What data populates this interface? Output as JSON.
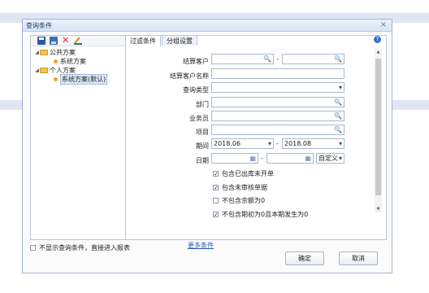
{
  "dialog": {
    "title": "查询条件",
    "close": "×"
  },
  "left": {
    "toolbar": {
      "save_icon": "save-icon",
      "saveas_icon": "save-as-icon",
      "delete_icon": "delete-icon",
      "edit_icon": "edit-icon"
    },
    "tree": [
      {
        "label": "公共方案",
        "children": [
          "系统方案"
        ]
      },
      {
        "label": "个人方案",
        "children": [
          "系统方案(默认)"
        ]
      }
    ]
  },
  "tabs": [
    "过滤条件",
    "分组设置"
  ],
  "help": "?",
  "form": {
    "customer": {
      "label": "结算客户",
      "from": "",
      "to": "",
      "dash": "-"
    },
    "customer_name": {
      "label": "结算客户名称",
      "value": ""
    },
    "query_type": {
      "label": "查询类型",
      "value": ""
    },
    "department": {
      "label": "部门",
      "value": ""
    },
    "salesperson": {
      "label": "业务员",
      "value": ""
    },
    "item": {
      "label": "项目",
      "value": ""
    },
    "period": {
      "label": "期间",
      "from": "2018.06",
      "to": "2018.08",
      "dash": "-"
    },
    "date": {
      "label": "日期",
      "from": "",
      "to": "",
      "dash": "-",
      "mode": "自定义"
    }
  },
  "options": [
    {
      "label": "包含已出库未开单",
      "checked": true
    },
    {
      "label": "包含未审核单据",
      "checked": true
    },
    {
      "label": "不包含余额为0",
      "checked": false
    },
    {
      "label": "不包含期初为0且本期发生为0",
      "checked": true
    }
  ],
  "more_link": "更多条件",
  "footer": {
    "skip_label": "不显示查询条件，直接进入报表",
    "ok": "确定",
    "cancel": "取消"
  }
}
